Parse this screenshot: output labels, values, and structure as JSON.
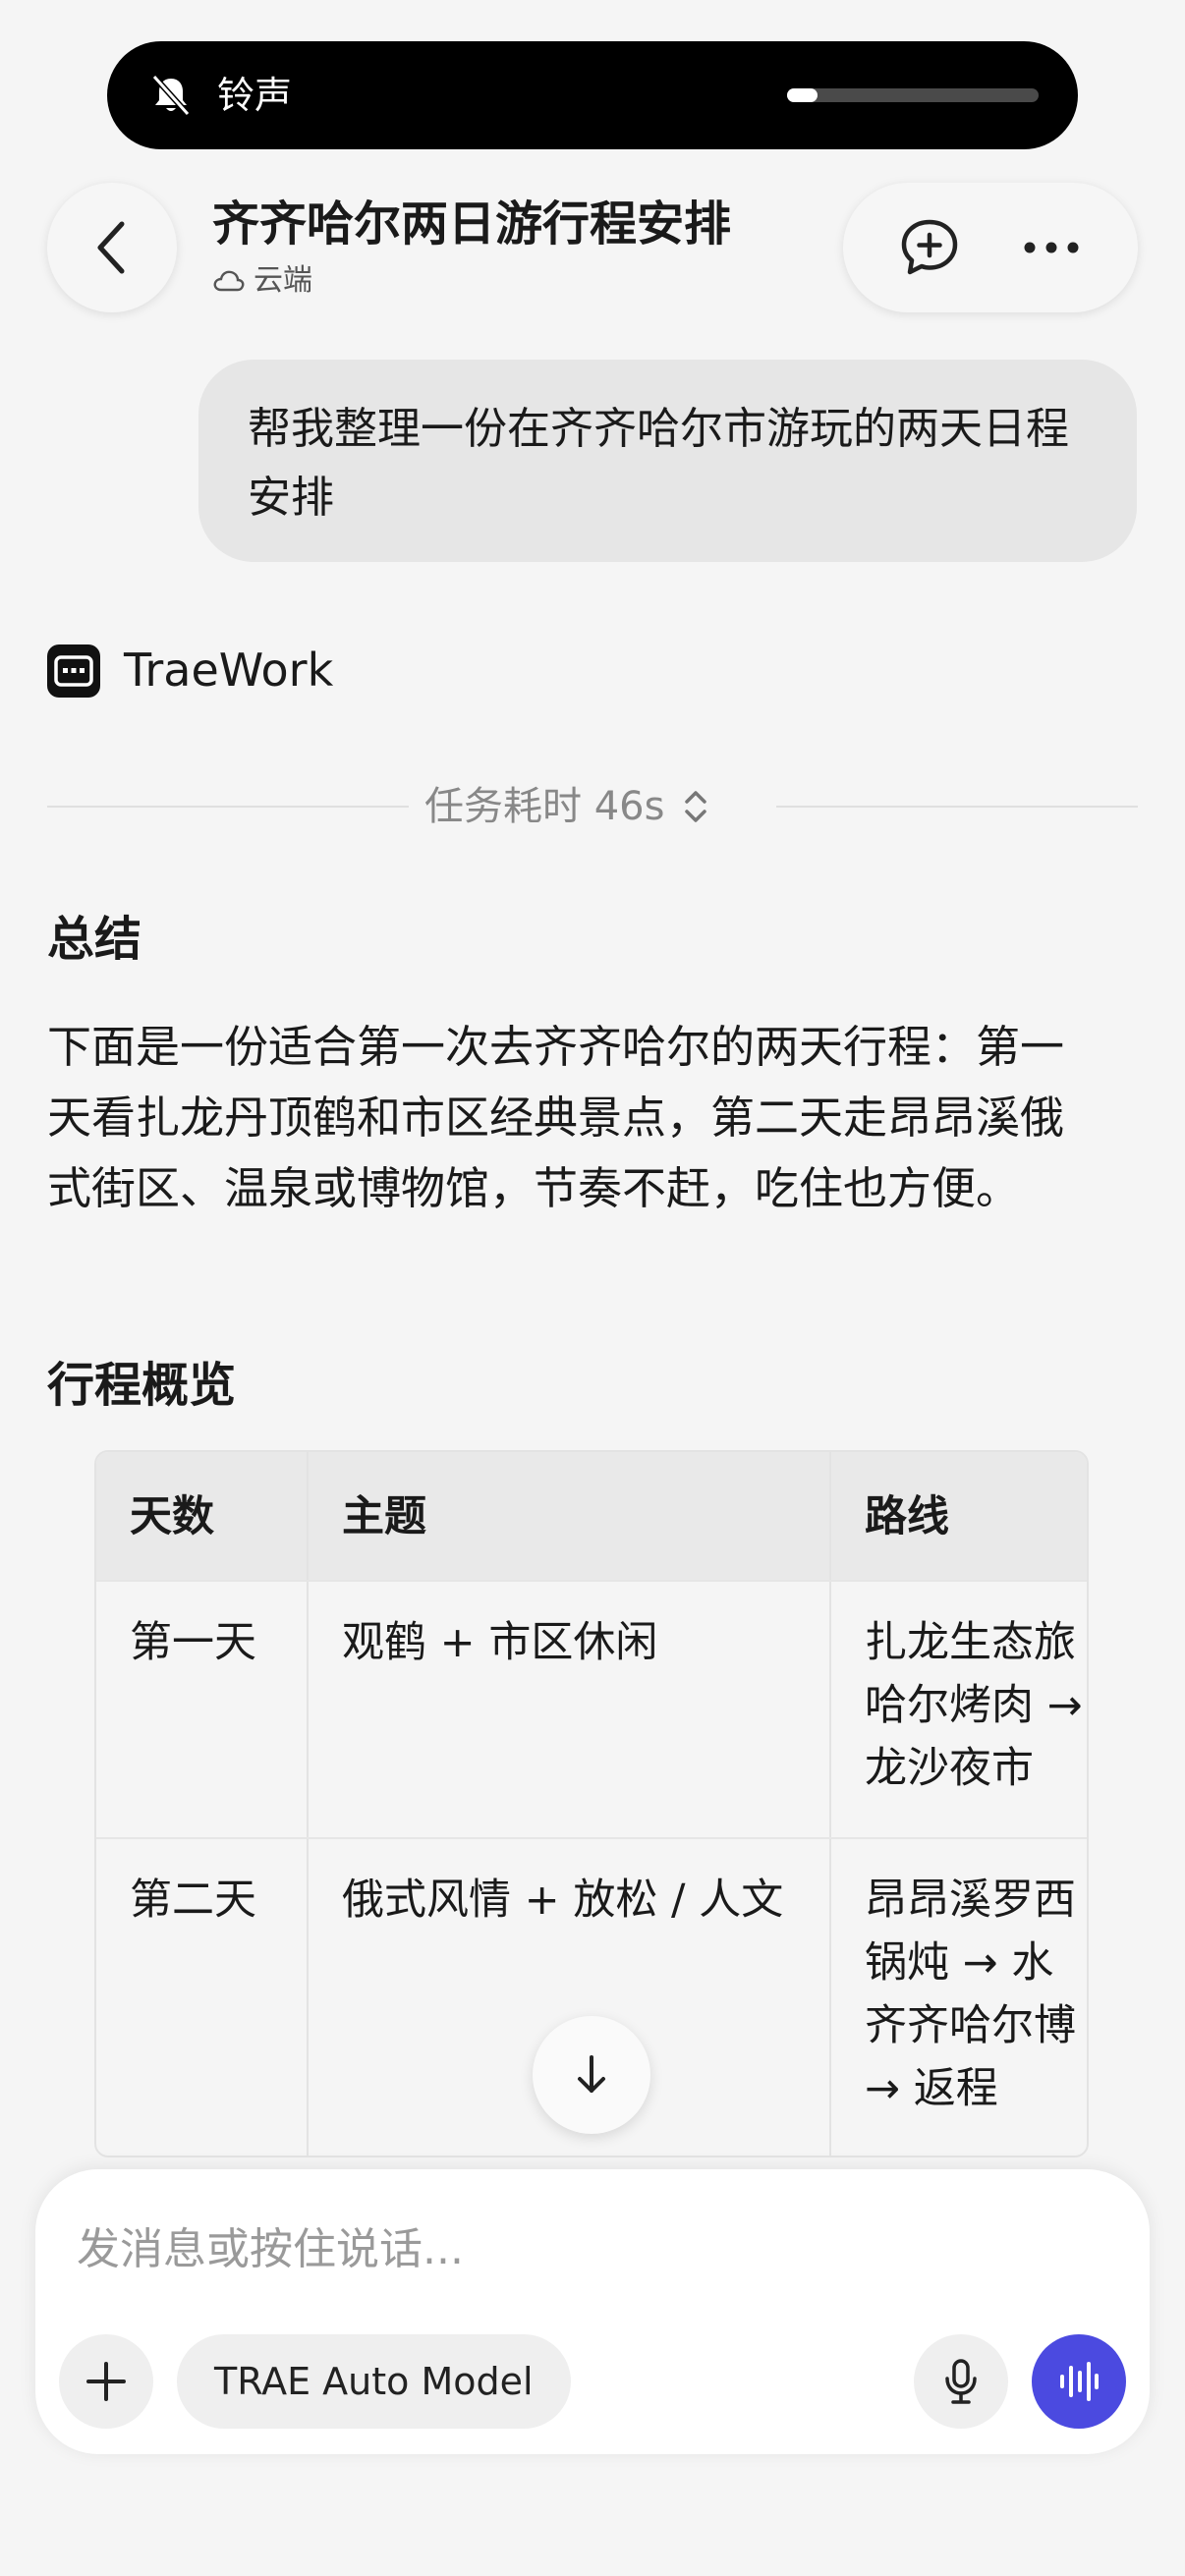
{
  "notification": {
    "label": "铃声",
    "icon": "bell-muted-icon",
    "volume_fraction": 0.12
  },
  "header": {
    "back_icon": "chevron-left-icon",
    "title": "齐齐哈尔两日游行程安排",
    "subtitle": "云端",
    "subtitle_icon": "cloud-icon",
    "actions": [
      "new-chat-icon",
      "more-icon"
    ]
  },
  "user_message": "帮我整理一份在齐齐哈尔市游玩的两天日程安排",
  "assistant": {
    "name": "TraeWork",
    "duration": "任务耗时 46s",
    "summary_heading": "总结",
    "summary_text": "下面是一份适合第一次去齐齐哈尔的两天行程：第一天看扎龙丹顶鹤和市区经典景点，第二天走昂昂溪俄式街区、温泉或博物馆，节奏不赶，吃住也方便。",
    "overview_heading": "行程概览",
    "table": {
      "headers": [
        "天数",
        "主题",
        "路线"
      ],
      "rows": [
        {
          "day": "第一天",
          "theme": "观鹤 + 市区休闲",
          "route": "扎龙生态旅\n哈尔烤肉 →\n龙沙夜市"
        },
        {
          "day": "第二天",
          "theme": "俄式风情 + 放松 / 人文",
          "route": "昂昂溪罗西\n锅炖 → 水\n齐齐哈尔博\n→ 返程"
        }
      ]
    }
  },
  "composer": {
    "placeholder": "发消息或按住说话...",
    "model": "TRAE Auto Model"
  },
  "colors": {
    "accent": "#4b4ae0",
    "bubble": "#e6e6e6",
    "background": "#f5f5f5"
  }
}
